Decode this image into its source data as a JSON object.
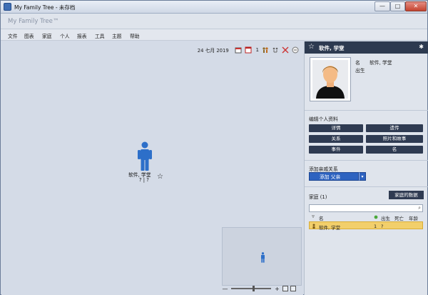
{
  "window": {
    "title": "My Family Tree - 未存档",
    "min": "—",
    "max": "□",
    "close": "✕"
  },
  "app": {
    "title": "My Family Tree™"
  },
  "menu": [
    "文件",
    "图表",
    "家庭",
    "个人",
    "报表",
    "工具",
    "主题",
    "帮助"
  ],
  "toolbar": {
    "date": "24 七月 2019",
    "count": "1"
  },
  "person": {
    "name": "软件, 学堂",
    "dates": "? | ?",
    "star": "☆"
  },
  "panel": {
    "name": "软件, 学堂",
    "star": "☆",
    "gear": "✱",
    "fields": {
      "name_label": "名",
      "name_value": "软件, 学堂",
      "birth_label": "出生"
    },
    "edit_title": "编辑个人资料",
    "buttons": [
      "详情",
      "遗传",
      "关系",
      "照片和故事",
      "事件",
      "名"
    ],
    "add_title": "添加亲戚关系",
    "add_button": "添加 父亲",
    "add_drop": "▾",
    "family_label": "家庭 (1)",
    "family_data_button": "家庭的数据",
    "search_icon": "⌕",
    "columns": {
      "name": "名",
      "birth": "出生",
      "death": "死亡",
      "age": "年龄"
    },
    "rows": [
      {
        "name": "软件, 学堂",
        "birth": "1",
        "death": "?"
      }
    ]
  },
  "zoom": {
    "minus": "—",
    "plus": "+"
  },
  "colors": {
    "header": "#2d3a50",
    "accent": "#2e63c0",
    "person": "#2d6fc9",
    "highlight": "#f2cf6b"
  }
}
